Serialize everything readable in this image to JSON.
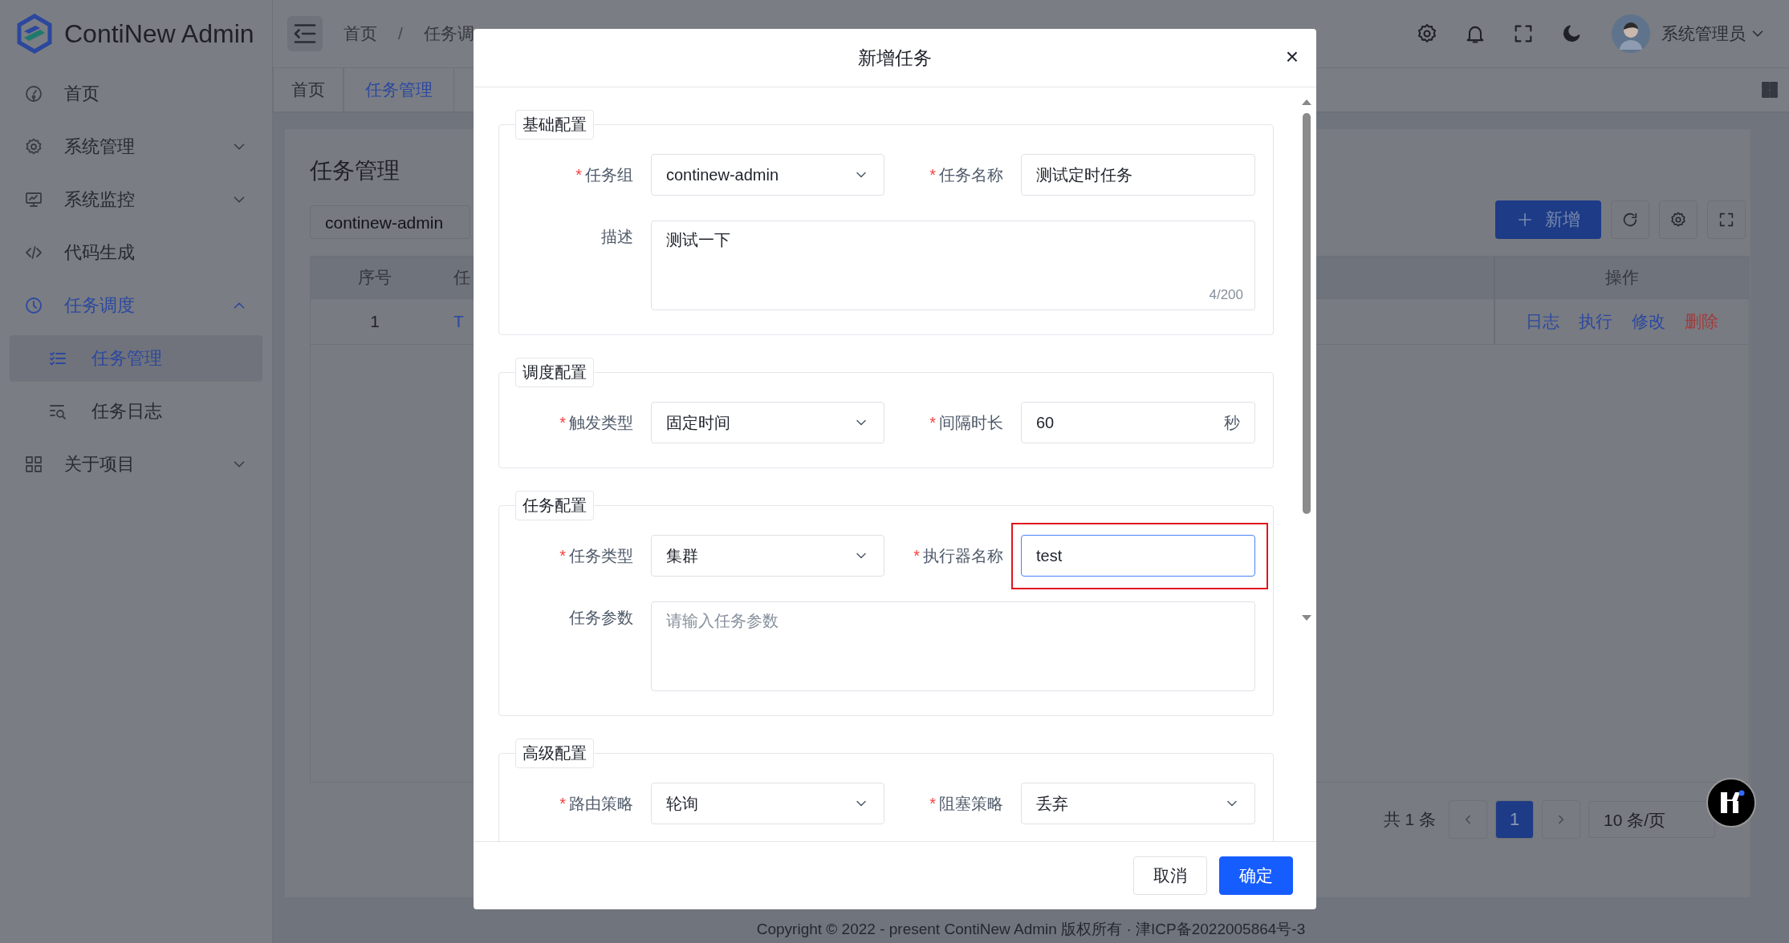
{
  "app": {
    "logo_text": "ContiNew Admin"
  },
  "sidebar": {
    "items": [
      {
        "label": "首页",
        "selected": false
      },
      {
        "label": "系统管理",
        "selected": false,
        "expanded": false
      },
      {
        "label": "系统监控",
        "selected": false,
        "expanded": false
      },
      {
        "label": "代码生成",
        "selected": false
      },
      {
        "label": "任务调度",
        "selected": true,
        "expanded": true,
        "children": [
          {
            "label": "任务管理",
            "selected": true
          },
          {
            "label": "任务日志",
            "selected": false
          }
        ]
      },
      {
        "label": "关于项目",
        "selected": false,
        "expanded": false
      }
    ]
  },
  "header": {
    "breadcrumb": [
      "首页",
      "任务调"
    ],
    "breadcrumb_separator": "/",
    "user_name": "系统管理员"
  },
  "tabs": [
    {
      "label": "首页",
      "selected": false
    },
    {
      "label": "任务管理",
      "selected": true
    }
  ],
  "page": {
    "title": "任务管理",
    "group_select": {
      "value": "continew-admin"
    },
    "add_button": "新增",
    "table": {
      "columns": [
        "序号",
        "任"
      ],
      "actions_column": "操作",
      "rows": [
        {
          "cells": [
            "1",
            "T"
          ],
          "actions": [
            {
              "label": "日志",
              "kind": "link"
            },
            {
              "label": "执行",
              "kind": "link"
            },
            {
              "label": "修改",
              "kind": "link"
            },
            {
              "label": "删除",
              "kind": "danger"
            }
          ]
        }
      ]
    },
    "pagination": {
      "total": "共 1 条",
      "pages": [
        {
          "label": "1",
          "selected": true
        }
      ],
      "page_size": "10 条/页"
    }
  },
  "footer": {
    "copyright": "Copyright © 2022 - present ContiNew Admin 版权所有 · 津ICP备2022005864号-3"
  },
  "modal": {
    "title": "新增任务",
    "close": "×",
    "sections": [
      {
        "legend": "基础配置",
        "fields": [
          {
            "label": "任务组",
            "required_mark": "*",
            "kind": "select",
            "value": "continew-admin"
          },
          {
            "label": "任务名称",
            "required_mark": "*",
            "kind": "input",
            "value": "测试定时任务"
          },
          {
            "label": "描述",
            "kind": "textarea",
            "value": "测试一下",
            "counter": "4/200"
          }
        ]
      },
      {
        "legend": "调度配置",
        "fields": [
          {
            "label": "触发类型",
            "required_mark": "*",
            "kind": "select",
            "value": "固定时间"
          },
          {
            "label": "间隔时长",
            "required_mark": "*",
            "kind": "input",
            "value": "60",
            "suffix": "秒"
          }
        ]
      },
      {
        "legend": "任务配置",
        "fields": [
          {
            "label": "任务类型",
            "required_mark": "*",
            "kind": "select",
            "value": "集群"
          },
          {
            "label": "执行器名称",
            "required_mark": "*",
            "kind": "input",
            "value": "test",
            "focused": true,
            "highlighted": true
          },
          {
            "label": "任务参数",
            "kind": "textarea",
            "placeholder": "请输入任务参数"
          }
        ]
      },
      {
        "legend": "高级配置",
        "fields": [
          {
            "label": "路由策略",
            "required_mark": "*",
            "kind": "select",
            "value": "轮询"
          },
          {
            "label": "阻塞策略",
            "required_mark": "*",
            "kind": "select",
            "value": "丢弃"
          }
        ]
      }
    ],
    "buttons": [
      {
        "label": "取消",
        "kind": "secondary"
      },
      {
        "label": "确定",
        "kind": "primary"
      }
    ]
  }
}
